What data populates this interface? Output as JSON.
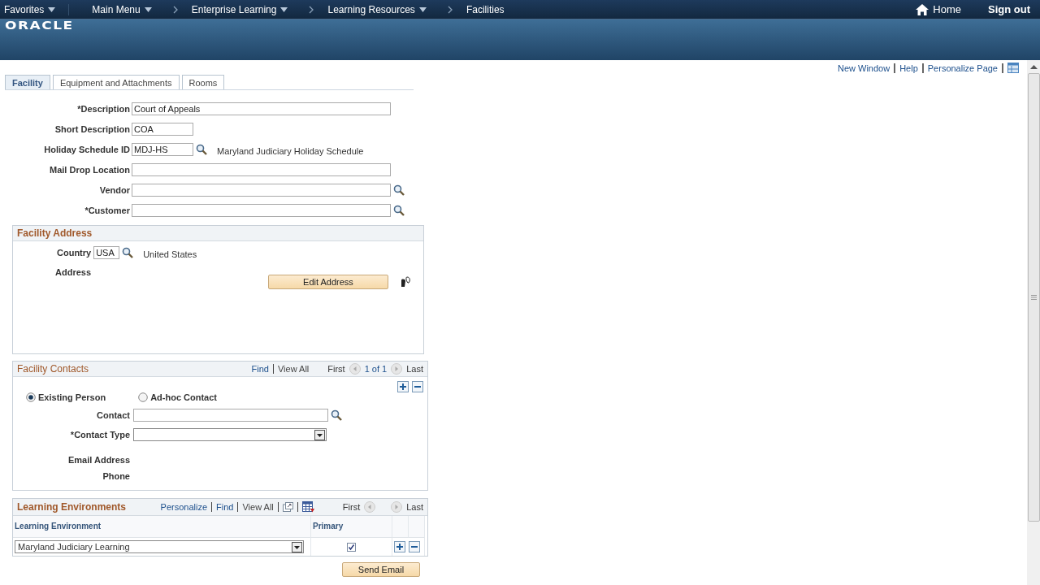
{
  "nav": {
    "items": [
      {
        "label": "Favorites",
        "kind": "menu",
        "dropdown": true
      },
      {
        "label": "Main Menu",
        "kind": "menu",
        "dropdown": true
      },
      {
        "label": "Enterprise Learning",
        "kind": "crumb",
        "dropdown": true
      },
      {
        "label": "Learning Resources",
        "kind": "crumb",
        "dropdown": true
      },
      {
        "label": "Facilities",
        "kind": "crumb",
        "dropdown": false
      }
    ],
    "home": "Home",
    "sign_out": "Sign out"
  },
  "logo": "ORACLE",
  "page_links": [
    "New Window",
    "Help",
    "Personalize Page"
  ],
  "tabs": [
    {
      "label": "Facility",
      "selected": true
    },
    {
      "label": "Equipment and Attachments",
      "selected": false
    },
    {
      "label": "Rooms",
      "selected": false
    }
  ],
  "fields": [
    {
      "label": "*Description",
      "value": "Court of Appeals",
      "kind": "long",
      "lookup": false
    },
    {
      "label": "Short Description",
      "value": "COA",
      "kind": "short",
      "lookup": false
    },
    {
      "label": "Holiday Schedule ID",
      "value": "MDJ-HS",
      "kind": "short",
      "lookup": true,
      "description": "Maryland Judiciary Holiday Schedule"
    },
    {
      "label": "Mail Drop Location",
      "kind": "long",
      "lookup": false
    },
    {
      "label": "Vendor",
      "kind": "long",
      "lookup": true
    },
    {
      "label": "*Customer",
      "kind": "long",
      "lookup": true
    }
  ],
  "facility_address": {
    "title": "Facility Address",
    "country_label": "Country",
    "country_value": "USA",
    "country_description": "United States",
    "address_label": "Address",
    "edit_button": "Edit Address"
  },
  "facility_contacts": {
    "title": "Facility Contacts",
    "links": [
      "Find",
      "View All"
    ],
    "first": "First",
    "counter": "1 of 1",
    "last": "Last",
    "radios": [
      {
        "label": "Existing Person",
        "selected": true
      },
      {
        "label": "Ad-hoc Contact",
        "selected": false
      }
    ],
    "contact_label": "Contact",
    "contact_type_label": "*Contact Type",
    "email_label": "Email Address",
    "phone_label": "Phone"
  },
  "learning_environments": {
    "title": "Learning Environments",
    "links": [
      "Personalize",
      "Find",
      "View All"
    ],
    "first": "First",
    "last": "Last",
    "columns": [
      "Learning Environment",
      "Primary"
    ],
    "rows": [
      {
        "environment": "Maryland Judiciary Learning",
        "primary": true
      }
    ]
  },
  "send_email": "Send Email"
}
